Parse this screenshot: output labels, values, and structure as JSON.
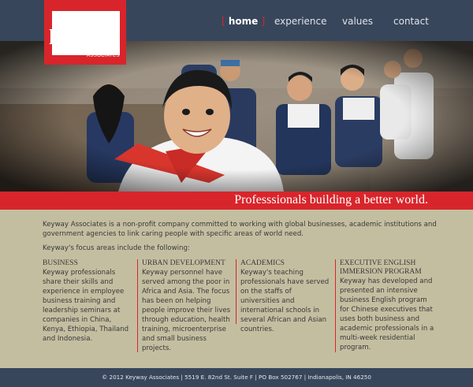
{
  "brand": {
    "name": "keyway",
    "sub": "ASSOCIATES"
  },
  "nav": {
    "bracket_open": "[",
    "bracket_close": "]",
    "items": [
      {
        "label": "home",
        "active": true
      },
      {
        "label": "experience",
        "active": false
      },
      {
        "label": "values",
        "active": false
      },
      {
        "label": "contact",
        "active": false
      }
    ]
  },
  "hero": {
    "tagline": "Professsionals building a better world."
  },
  "main": {
    "intro": "Keyway Associates is a non-profit company committed to working with global businesses, academic institutions and government agencies to link caring people with specific areas of world need.",
    "focus_lead": "Keyway's focus areas include the following:",
    "columns": [
      {
        "title": "BUSINESS",
        "body": "Keyway professionals share their skills and experience in employee business training and leadership seminars at companies in China, Kenya, Ethiopia, Thailand and Indonesia."
      },
      {
        "title": "URBAN DEVELOPMENT",
        "body": "Keyway personnel have served among the poor in Africa and Asia. The focus has been on helping people improve their lives through education, health training, microenterprise and small business projects."
      },
      {
        "title": "ACADEMICS",
        "body": "Keyway's teaching professionals have served on the staffs of universities and international schools in several African and Asian countries."
      },
      {
        "title": "EXECUTIVE ENGLISH IMMERSION PROGRAM",
        "body": "Keyway has developed and presented an intensive business English program for Chinese executives that uses both business and academic professionals in a multi-week residential program."
      }
    ]
  },
  "footer": {
    "text": "© 2012 Keyway Associates | 5519 E. 82nd St. Suite F | PO Box 502767 | Indianapolis, IN 46250"
  },
  "colors": {
    "navy": "#38465b",
    "accent_red": "#d8252b",
    "content_tan": "#c4bea1"
  }
}
